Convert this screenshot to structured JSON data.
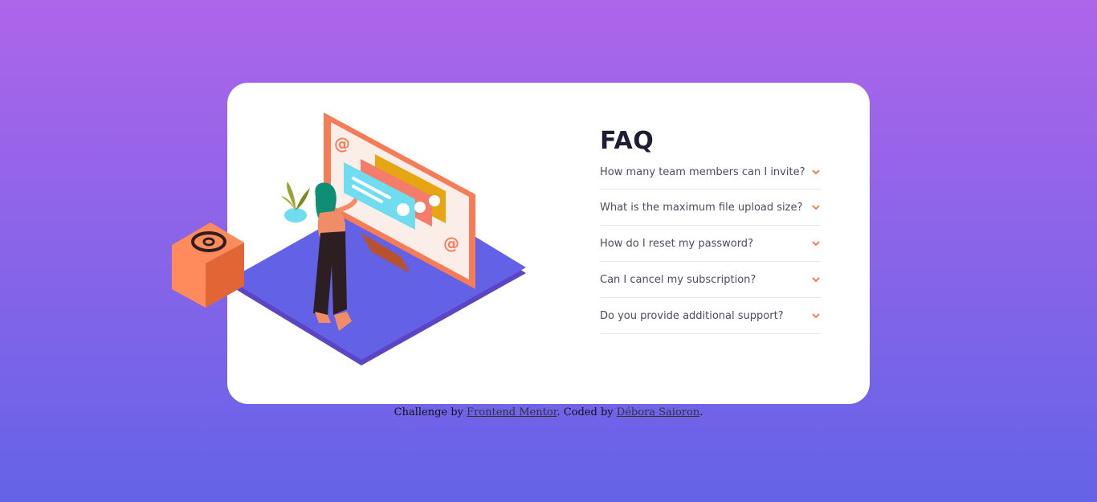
{
  "faq": {
    "title": "FAQ",
    "items": [
      {
        "question": "How many team members can I invite?"
      },
      {
        "question": "What is the maximum file upload size?"
      },
      {
        "question": "How do I reset my password?"
      },
      {
        "question": "Can I cancel my subscription?"
      },
      {
        "question": "Do you provide additional support?"
      }
    ],
    "chevron_icon": "chevron-down-icon",
    "accent_color": "#f47c57"
  },
  "attribution": {
    "prefix": "Challenge by",
    "mentor_link": "Frontend Mentor",
    "middle": ". Coded by",
    "author_link": "Débora Saioron",
    "suffix": "."
  },
  "colors": {
    "background_top": "#ae65ea",
    "background_bottom": "#6463e7",
    "card": "#ffffff",
    "heading": "#1d1e35",
    "question_text": "#4b4c5f",
    "divider": "#e7e7e9"
  }
}
